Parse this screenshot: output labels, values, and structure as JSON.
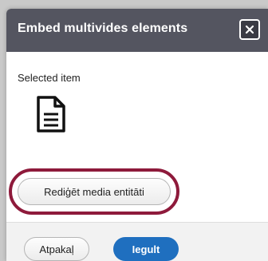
{
  "dialog": {
    "title": "Embed multivides elements",
    "close_icon": "close-icon",
    "section_label": "Selected item",
    "item_icon": "document-icon",
    "edit_button_label": "Rediģēt media entitāti"
  },
  "footer": {
    "back_label": "Atpakaļ",
    "insert_label": "Iegult"
  },
  "colors": {
    "titlebar": "#545560",
    "highlight": "#8e1a3b",
    "primary": "#1f6fbf"
  }
}
